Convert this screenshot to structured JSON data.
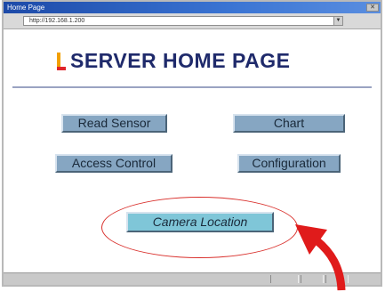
{
  "window": {
    "title": "Home Page"
  },
  "address": {
    "url": "http://192.168.1.200"
  },
  "page": {
    "heading": "SERVER HOME PAGE"
  },
  "buttons": {
    "read_sensor": "Read Sensor",
    "chart": "Chart",
    "access_control": "Access Control",
    "configuration": "Configuration",
    "camera_location": "Camera Location"
  },
  "colors": {
    "button_fill": "#86a6c2",
    "highlight_button_fill": "#7fc6d8",
    "annotation_red": "#e01b1b",
    "heading_color": "#1f2a6b"
  },
  "icons": {
    "logo": "server-logo-icon",
    "annotation": "pointer-arrow-icon"
  }
}
